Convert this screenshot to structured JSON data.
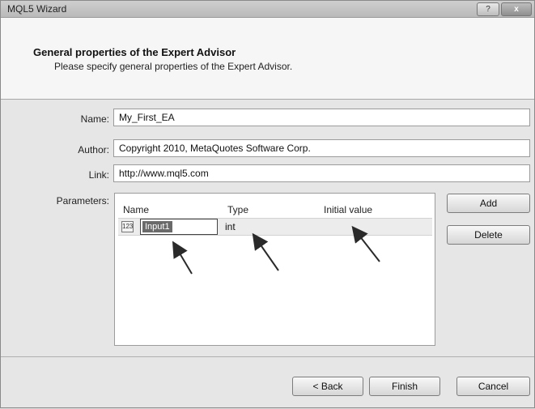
{
  "window": {
    "title": "MQL5 Wizard",
    "help_label": "?",
    "close_label": "x"
  },
  "header": {
    "title": "General properties of the Expert Advisor",
    "subtitle": "Please specify general properties of the Expert Advisor."
  },
  "form": {
    "name_label": "Name:",
    "name_value": "My_First_EA",
    "author_label": "Author:",
    "author_value": "Copyright 2010, MetaQuotes Software Corp.",
    "link_label": "Link:",
    "link_value": "http://www.mql5.com",
    "parameters_label": "Parameters:"
  },
  "parameters": {
    "columns": [
      "Name",
      "Type",
      "Initial value"
    ],
    "rows": [
      {
        "icon": "123",
        "name": "Input1",
        "type": "int",
        "initial_value": ""
      }
    ]
  },
  "side_buttons": {
    "add": "Add",
    "delete": "Delete"
  },
  "footer": {
    "back": "< Back",
    "finish": "Finish",
    "cancel": "Cancel"
  },
  "colors": {
    "accent": "#6a6a6a",
    "window_bg": "#e6e6e6"
  }
}
